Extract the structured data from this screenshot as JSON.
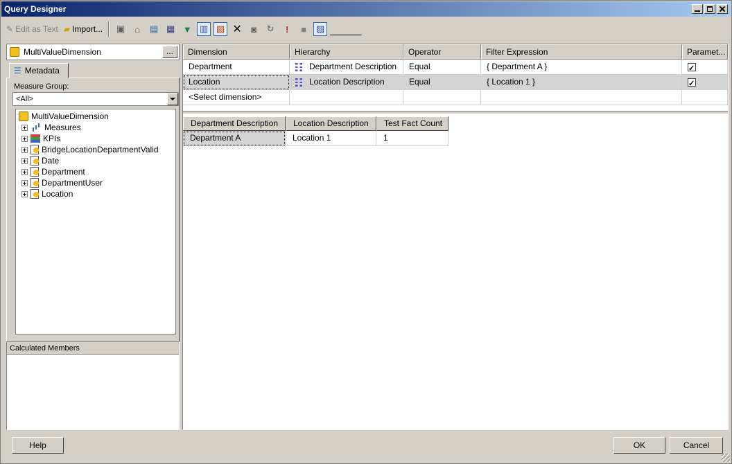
{
  "window": {
    "title": "Query Designer"
  },
  "toolbar": {
    "edit_as_text": "Edit as Text",
    "import": "Import..."
  },
  "cube": {
    "name": "MultiValueDimension",
    "browse_label": "..."
  },
  "metadata": {
    "tab_label": "Metadata",
    "measure_group_label": "Measure Group:",
    "measure_group_value": "<All>",
    "tree_root": "MultiValueDimension",
    "tree_items": [
      {
        "label": "Measures",
        "icon": "measures-icon"
      },
      {
        "label": "KPIs",
        "icon": "kpi-icon"
      },
      {
        "label": "BridgeLocationDepartmentValid",
        "icon": "dimension-icon"
      },
      {
        "label": "Date",
        "icon": "dimension-icon"
      },
      {
        "label": "Department",
        "icon": "dimension-icon"
      },
      {
        "label": "DepartmentUser",
        "icon": "dimension-icon"
      },
      {
        "label": "Location",
        "icon": "dimension-icon"
      }
    ]
  },
  "calculated_members": {
    "header": "Calculated Members"
  },
  "filter_grid": {
    "columns": [
      "Dimension",
      "Hierarchy",
      "Operator",
      "Filter Expression",
      "Paramet..."
    ],
    "rows": [
      {
        "dimension": "Department",
        "hierarchy": "Department Description",
        "operator": "Equal",
        "filter": "{ Department A }",
        "parameter": true
      },
      {
        "dimension": "Location",
        "hierarchy": "Location Description",
        "operator": "Equal",
        "filter": "{ Location 1 }",
        "parameter": true
      }
    ],
    "new_row": "<Select dimension>"
  },
  "results": {
    "columns": [
      "Department Description",
      "Location Description",
      "Test Fact Count"
    ],
    "rows": [
      [
        "Department A",
        "Location 1",
        "1"
      ]
    ]
  },
  "buttons": {
    "help": "Help",
    "ok": "OK",
    "cancel": "Cancel"
  }
}
